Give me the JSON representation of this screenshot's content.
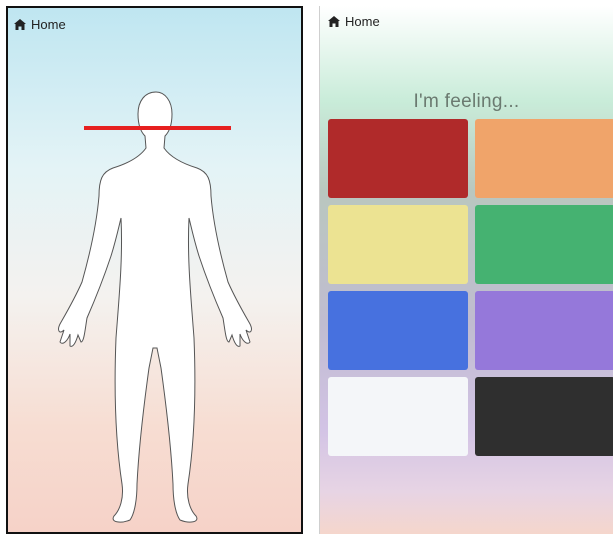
{
  "left_panel": {
    "home_label": "Home"
  },
  "right_panel": {
    "home_label": "Home",
    "title": "I'm feeling...",
    "tiles": [
      {
        "color": "#b02a2a"
      },
      {
        "color": "#f0a46a"
      },
      {
        "color": "#ece392"
      },
      {
        "color": "#45b271"
      },
      {
        "color": "#4771df"
      },
      {
        "color": "#9578da"
      },
      {
        "color": "#f4f6f9"
      },
      {
        "color": "#2f2f2f"
      }
    ]
  },
  "colors": {
    "marker_line": "#e62020",
    "body_fill": "#ffffff",
    "body_stroke": "#555555"
  },
  "icons": [
    "home-icon",
    "body-silhouette"
  ]
}
